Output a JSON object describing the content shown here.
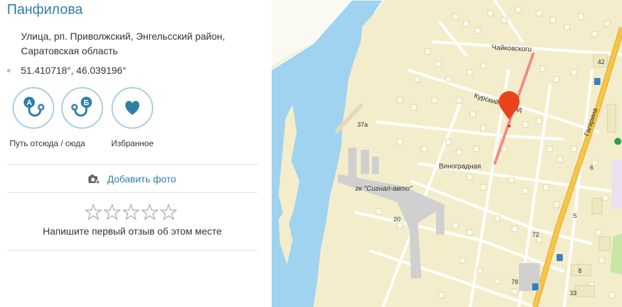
{
  "place": {
    "title": "Панфилова",
    "address": "Улица, рп. Приволжский, Энгельсский район, Саратовская область",
    "coordinates": "51.410718°, 46.039196°"
  },
  "actions": [
    {
      "label": "Путь отсюда / сюда",
      "icon": "route-a-icon",
      "badge": "А"
    },
    {
      "label": "",
      "icon": "route-b-icon",
      "badge": "Б"
    },
    {
      "label": "Избранное",
      "icon": "heart-icon"
    }
  ],
  "add_photo": {
    "label": "Добавить фото",
    "icon": "camera-plus-icon"
  },
  "rating": {
    "stars": 5,
    "filled": 0
  },
  "review_prompt": "Напишите первый отзыв об этом месте",
  "map": {
    "labels": {
      "chaikovskogo": "Чайковского",
      "kursky": "Курский проезд",
      "vinogradnaya": "Виноградная",
      "gagarina": "Гагарина",
      "gk": "гк \"Сигнал-авто\"",
      "n37a": "37а",
      "n42": "42",
      "n20": "20",
      "n72": "72",
      "n78": "78",
      "n8": "8",
      "n33": "33",
      "n6": "6",
      "n5": "5"
    },
    "colors": {
      "land": "#f4edcb",
      "water": "#9fd3f0",
      "road": "#ffffff",
      "highway": "#f6c646",
      "highlight": "#f08a8a",
      "marker": "#e8431a"
    }
  }
}
